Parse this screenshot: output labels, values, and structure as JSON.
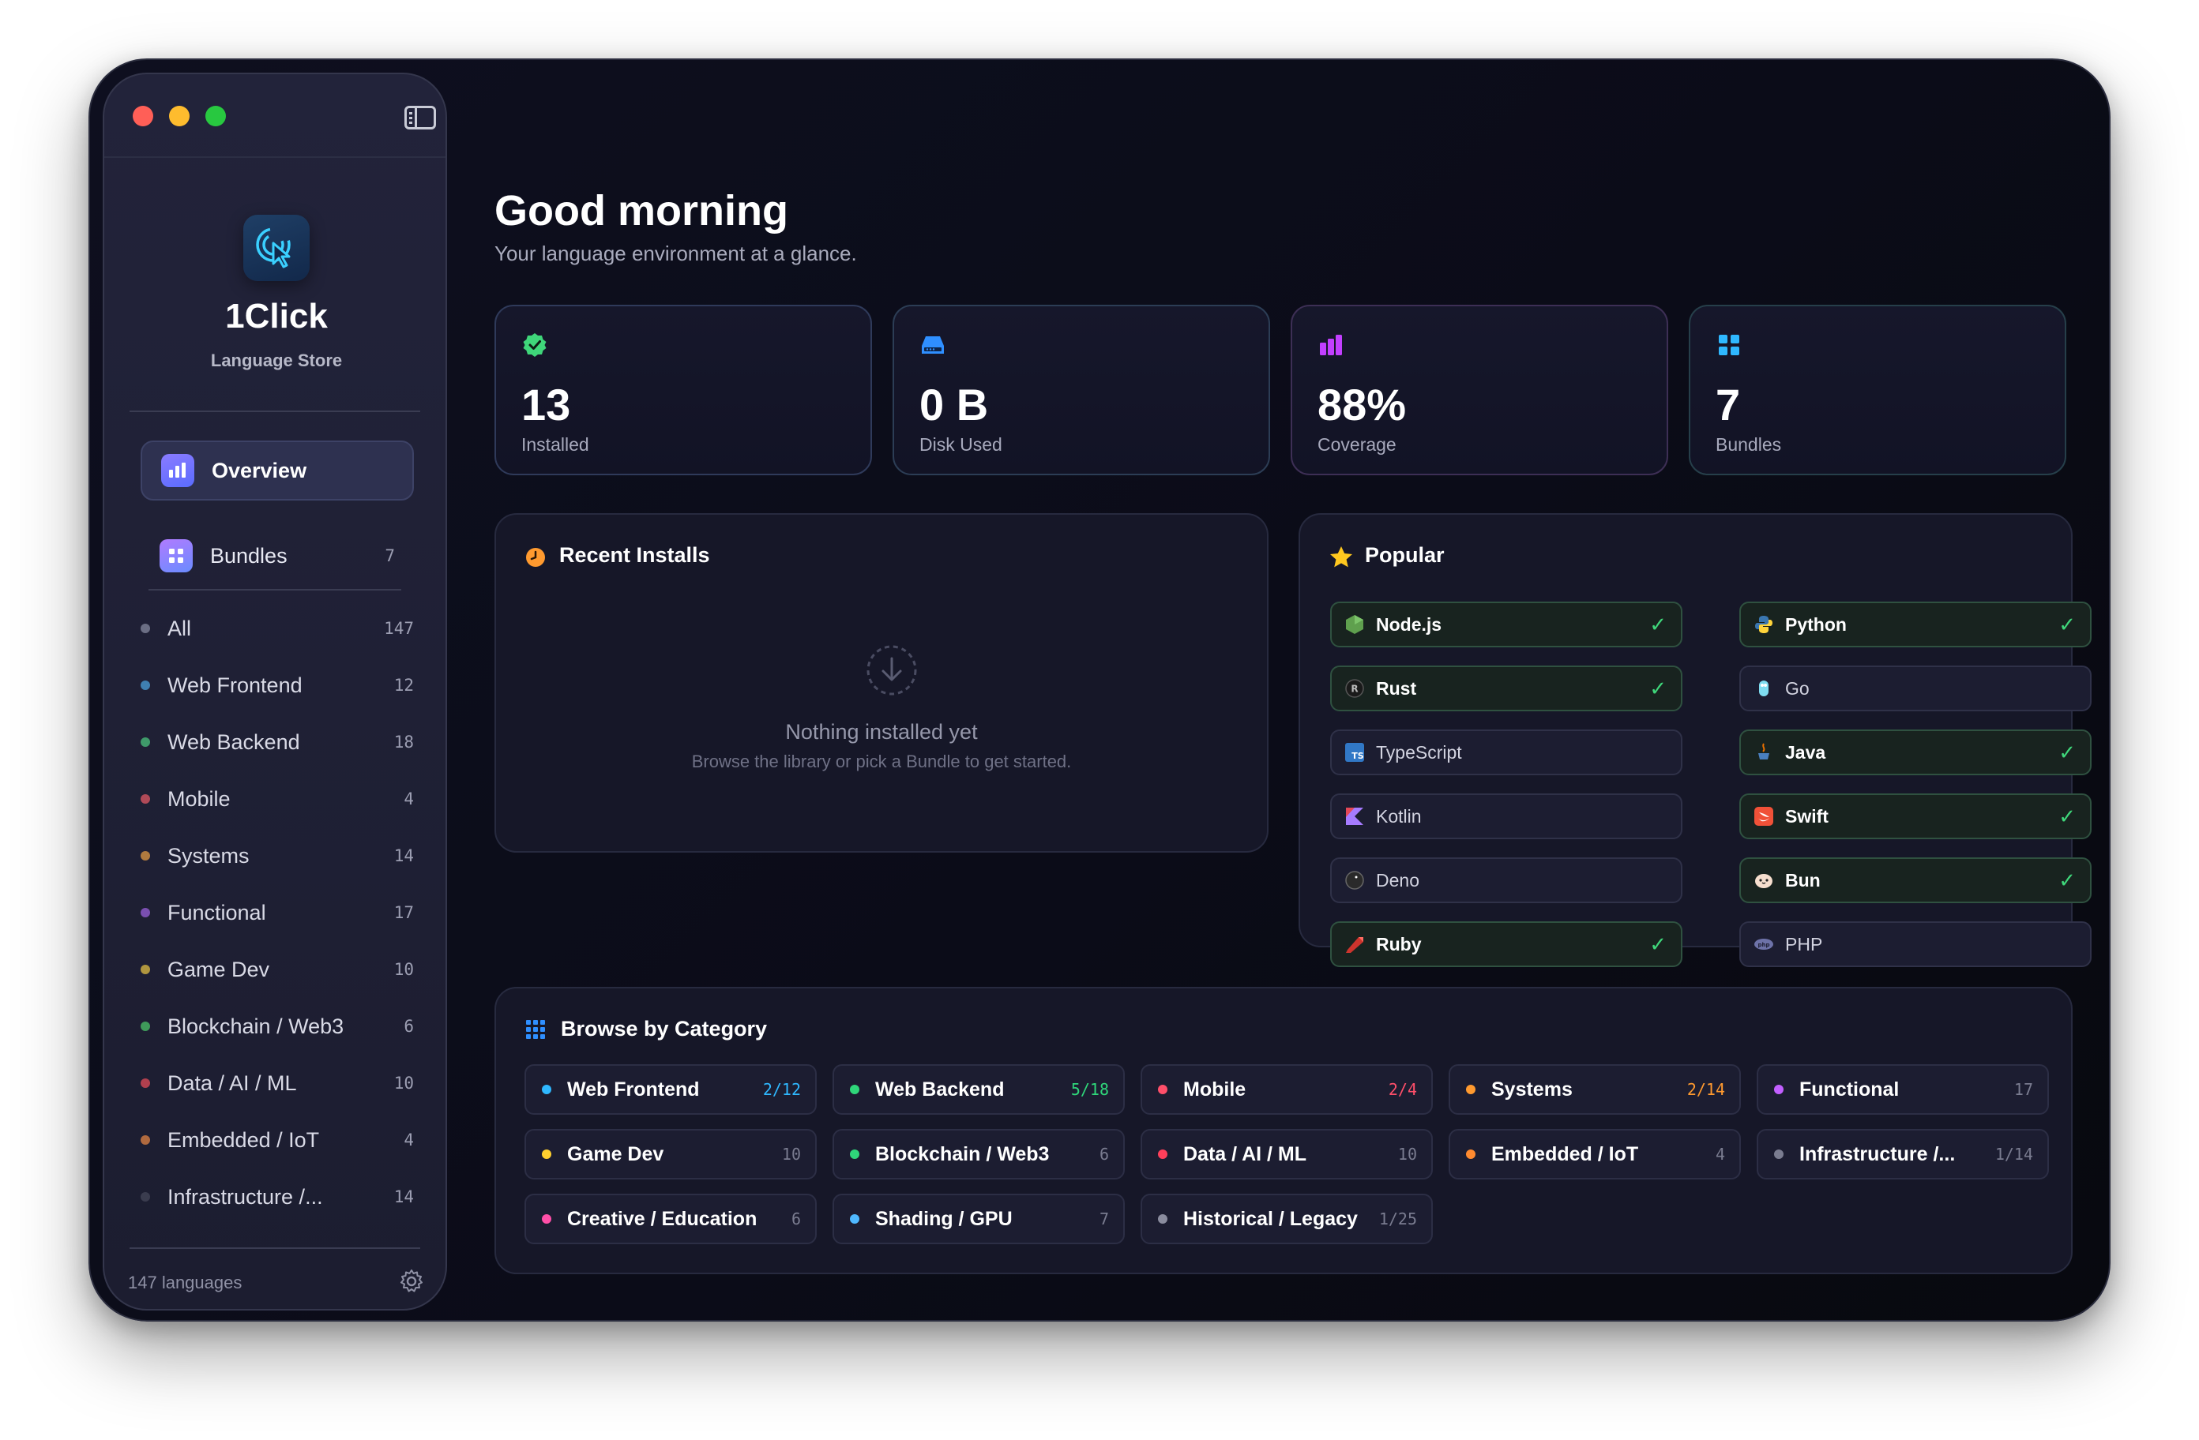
{
  "sidebar": {
    "app_name": "1Click",
    "app_subtitle": "Language Store",
    "nav": [
      {
        "label": "Overview",
        "count": ""
      },
      {
        "label": "Bundles",
        "count": "7"
      }
    ],
    "categories": [
      {
        "label": "All",
        "count": "147",
        "color": "#6b6e84"
      },
      {
        "label": "Web Frontend",
        "count": "12",
        "color": "#3f7fb0"
      },
      {
        "label": "Web Backend",
        "count": "18",
        "color": "#3f9a6a"
      },
      {
        "label": "Mobile",
        "count": "4",
        "color": "#b04a58"
      },
      {
        "label": "Systems",
        "count": "14",
        "color": "#b07a3f"
      },
      {
        "label": "Functional",
        "count": "17",
        "color": "#7a4fb0"
      },
      {
        "label": "Game Dev",
        "count": "10",
        "color": "#b0963f"
      },
      {
        "label": "Blockchain / Web3",
        "count": "6",
        "color": "#3f9a5a"
      },
      {
        "label": "Data / AI / ML",
        "count": "10",
        "color": "#b0404e"
      },
      {
        "label": "Embedded / IoT",
        "count": "4",
        "color": "#b06a3f"
      },
      {
        "label": "Infrastructure /...",
        "count": "14",
        "color": "#3a3c4e"
      }
    ],
    "footer_text": "147 languages"
  },
  "main": {
    "greeting": "Good morning",
    "subtitle": "Your language environment at a glance.",
    "stats": [
      {
        "value": "13",
        "label": "Installed",
        "accent": "#3fd67a",
        "border": "#2f3a5a"
      },
      {
        "value": "0 B",
        "label": "Disk Used",
        "accent": "#2f8fff",
        "border": "#2c3d55"
      },
      {
        "value": "88%",
        "label": "Coverage",
        "accent": "#c23fff",
        "border": "#3d2f55"
      },
      {
        "value": "7",
        "label": "Bundles",
        "accent": "#2fb8ff",
        "border": "#263f4a"
      }
    ],
    "recent": {
      "title": "Recent Installs",
      "empty_title": "Nothing installed yet",
      "empty_sub": "Browse the library or pick a Bundle to get started."
    },
    "popular": {
      "title": "Popular",
      "languages": [
        {
          "name": "Node.js",
          "installed": true
        },
        {
          "name": "Python",
          "installed": true
        },
        {
          "name": "Rust",
          "installed": true
        },
        {
          "name": "Go",
          "installed": false
        },
        {
          "name": "TypeScript",
          "installed": false
        },
        {
          "name": "Java",
          "installed": true
        },
        {
          "name": "Kotlin",
          "installed": false
        },
        {
          "name": "Swift",
          "installed": true
        },
        {
          "name": "Deno",
          "installed": false
        },
        {
          "name": "Bun",
          "installed": true
        },
        {
          "name": "Ruby",
          "installed": true
        },
        {
          "name": "PHP",
          "installed": false
        }
      ],
      "check_glyph": "✓"
    },
    "browse": {
      "title": "Browse by Category",
      "categories": [
        {
          "label": "Web Frontend",
          "count": "2/12",
          "dot": "#2fb8ff",
          "count_color": "#2fb8ff"
        },
        {
          "label": "Web Backend",
          "count": "5/18",
          "dot": "#2fd67a",
          "count_color": "#2fd67a"
        },
        {
          "label": "Mobile",
          "count": "2/4",
          "dot": "#ff4f6a",
          "count_color": "#ff4f6a"
        },
        {
          "label": "Systems",
          "count": "2/14",
          "dot": "#ff9a2f",
          "count_color": "#ff9a2f"
        },
        {
          "label": "Functional",
          "count": "17",
          "dot": "#c25fff",
          "count_color": "#7a7c90"
        },
        {
          "label": "Game Dev",
          "count": "10",
          "dot": "#ffd02f",
          "count_color": "#7a7c90"
        },
        {
          "label": "Blockchain / Web3",
          "count": "6",
          "dot": "#2fd67a",
          "count_color": "#7a7c90"
        },
        {
          "label": "Data / AI / ML",
          "count": "10",
          "dot": "#ff3f5a",
          "count_color": "#7a7c90"
        },
        {
          "label": "Embedded / IoT",
          "count": "4",
          "dot": "#ff8a2f",
          "count_color": "#7a7c90"
        },
        {
          "label": "Infrastructure /...",
          "count": "1/14",
          "dot": "#7a7c90",
          "count_color": "#7a7c90"
        },
        {
          "label": "Creative / Education",
          "count": "6",
          "dot": "#ff4fa8",
          "count_color": "#7a7c90"
        },
        {
          "label": "Shading / GPU",
          "count": "7",
          "dot": "#4fb8ff",
          "count_color": "#7a7c90"
        },
        {
          "label": "Historical / Legacy",
          "count": "1/25",
          "dot": "#8a8c9e",
          "count_color": "#7a7c90"
        }
      ]
    }
  }
}
